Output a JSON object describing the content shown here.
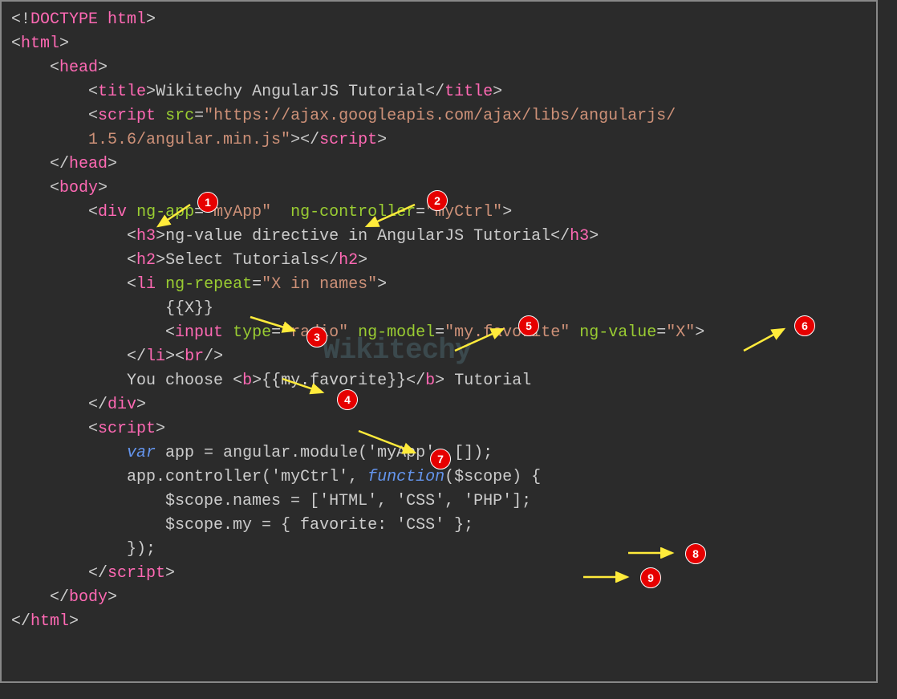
{
  "code": {
    "l1": "<!DOCTYPE html>",
    "l2_open": "html",
    "l3_open": "head",
    "l4_tag": "title",
    "l4_text": "Wikitechy AngularJS Tutorial",
    "l5_tag": "script",
    "l5_attr": "src",
    "l5_val": "\"https://ajax.googleapis.com/ajax/libs/angularjs/",
    "l6_val": "1.5.6/angular.min.js\"",
    "l7_close": "head",
    "l8_open": "body",
    "l9_tag": "div",
    "l9_attr1": "ng-app",
    "l9_val1": "\"myApp\"",
    "l9_attr2": "ng-controller",
    "l9_val2": "\"myCtrl\"",
    "l10_tag": "h3",
    "l10_text": "ng-value directive in AngularJS Tutorial",
    "l11_tag": "h2",
    "l11_text": "Select Tutorials",
    "l12_tag": "li",
    "l12_attr": "ng-repeat",
    "l12_val": "\"X in names\"",
    "l13_text": "{{X}}",
    "l14_tag": "input",
    "l14_attr1": "type",
    "l14_val1": "\"radio\"",
    "l14_attr2": "ng-model",
    "l14_val2": "\"my.favorite\"",
    "l14_attr3": "ng-value",
    "l14_val3": "\"X\"",
    "l15_tag1": "li",
    "l15_tag2": "br",
    "l16_text1": "You choose ",
    "l16_tag": "b",
    "l16_text2": "{{my.favorite}}",
    "l16_text3": " Tutorial",
    "l17_close": "div",
    "l18_tag": "script",
    "l19_text": "var",
    "l19_rest": " app = angular.module('myApp', []);",
    "l20_text1": "app.controller('myCtrl', ",
    "l20_func": "function",
    "l20_text2": "($scope) {",
    "l21_text": "$scope.names = ['HTML', 'CSS', 'PHP'];",
    "l22_text": "$scope.my = { favorite: 'CSS' };",
    "l23_text": "});",
    "l24_close": "script",
    "l25_close": "body",
    "l26_close": "html"
  },
  "annotations": {
    "b1": "1",
    "b2": "2",
    "b3": "3",
    "b4": "4",
    "b5": "5",
    "b6": "6",
    "b7": "7",
    "b8": "8",
    "b9": "9"
  },
  "watermark": "Wikitechy"
}
